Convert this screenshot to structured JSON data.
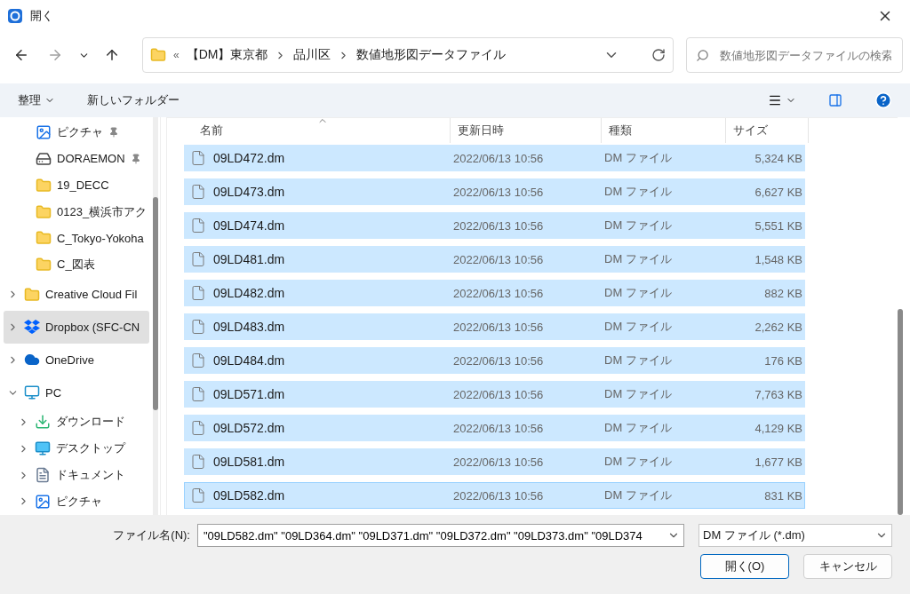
{
  "window": {
    "title": "開く"
  },
  "address_bar": {
    "overflow": "«",
    "segments": [
      "【DM】東京都",
      "品川区",
      "数値地形図データファイル"
    ]
  },
  "search": {
    "placeholder": "数値地形図データファイルの検索"
  },
  "command_bar": {
    "organize": "整理",
    "new_folder": "新しいフォルダー"
  },
  "sidebar": {
    "quick_access": [
      {
        "label": "ピクチャ",
        "kind": "picture",
        "pinned": true
      },
      {
        "label": "DORAEMON",
        "kind": "drive",
        "pinned": true
      },
      {
        "label": "19_DECC",
        "kind": "folder",
        "pinned": false
      },
      {
        "label": "0123_横浜市アク",
        "kind": "folder",
        "pinned": false
      },
      {
        "label": "C_Tokyo-Yokoha",
        "kind": "folder",
        "pinned": false
      },
      {
        "label": "C_図表",
        "kind": "folder",
        "pinned": false
      }
    ],
    "items": [
      {
        "label": "Creative Cloud Fil",
        "kind": "creative",
        "expanded": false,
        "selected": false
      },
      {
        "label": "Dropbox (SFC-CN",
        "kind": "dropbox",
        "expanded": false,
        "selected": true
      },
      {
        "label": "OneDrive",
        "kind": "cloud",
        "expanded": false,
        "selected": false
      },
      {
        "label": "PC",
        "kind": "pc",
        "expanded": true,
        "selected": false,
        "children": [
          {
            "label": "ダウンロード",
            "kind": "download",
            "expanded": false,
            "selected": false
          },
          {
            "label": "デスクトップ",
            "kind": "desktop",
            "expanded": false,
            "selected": false
          },
          {
            "label": "ドキュメント",
            "kind": "document",
            "expanded": false,
            "selected": false
          },
          {
            "label": "ピクチャ",
            "kind": "picture",
            "expanded": false,
            "selected": false
          }
        ]
      }
    ]
  },
  "table": {
    "columns": [
      {
        "label": "名前",
        "sorted": true
      },
      {
        "label": "更新日時",
        "sorted": false
      },
      {
        "label": "種類",
        "sorted": false
      },
      {
        "label": "サイズ",
        "sorted": false
      }
    ],
    "rows": [
      {
        "name": "09LD472.dm",
        "date": "2022/06/13 10:56",
        "type": "DM ファイル",
        "size": "5,324 KB",
        "selected": true,
        "focused": false
      },
      {
        "name": "09LD473.dm",
        "date": "2022/06/13 10:56",
        "type": "DM ファイル",
        "size": "6,627 KB",
        "selected": true,
        "focused": false
      },
      {
        "name": "09LD474.dm",
        "date": "2022/06/13 10:56",
        "type": "DM ファイル",
        "size": "5,551 KB",
        "selected": true,
        "focused": false
      },
      {
        "name": "09LD481.dm",
        "date": "2022/06/13 10:56",
        "type": "DM ファイル",
        "size": "1,548 KB",
        "selected": true,
        "focused": false
      },
      {
        "name": "09LD482.dm",
        "date": "2022/06/13 10:56",
        "type": "DM ファイル",
        "size": "882 KB",
        "selected": true,
        "focused": false
      },
      {
        "name": "09LD483.dm",
        "date": "2022/06/13 10:56",
        "type": "DM ファイル",
        "size": "2,262 KB",
        "selected": true,
        "focused": false
      },
      {
        "name": "09LD484.dm",
        "date": "2022/06/13 10:56",
        "type": "DM ファイル",
        "size": "176 KB",
        "selected": true,
        "focused": false
      },
      {
        "name": "09LD571.dm",
        "date": "2022/06/13 10:56",
        "type": "DM ファイル",
        "size": "7,763 KB",
        "selected": true,
        "focused": false
      },
      {
        "name": "09LD572.dm",
        "date": "2022/06/13 10:56",
        "type": "DM ファイル",
        "size": "4,129 KB",
        "selected": true,
        "focused": false
      },
      {
        "name": "09LD581.dm",
        "date": "2022/06/13 10:56",
        "type": "DM ファイル",
        "size": "1,677 KB",
        "selected": true,
        "focused": false
      },
      {
        "name": "09LD582.dm",
        "date": "2022/06/13 10:56",
        "type": "DM ファイル",
        "size": "831 KB",
        "selected": true,
        "focused": true
      }
    ]
  },
  "footer": {
    "filename_label": "ファイル名(N):",
    "filename_value": "\"09LD582.dm\" \"09LD364.dm\" \"09LD371.dm\" \"09LD372.dm\" \"09LD373.dm\" \"09LD374",
    "filter": "DM ファイル (*.dm)",
    "buttons": [
      {
        "label": "開く(O)",
        "kind": "primary"
      },
      {
        "label": "キャンセル",
        "kind": "secondary"
      }
    ]
  }
}
